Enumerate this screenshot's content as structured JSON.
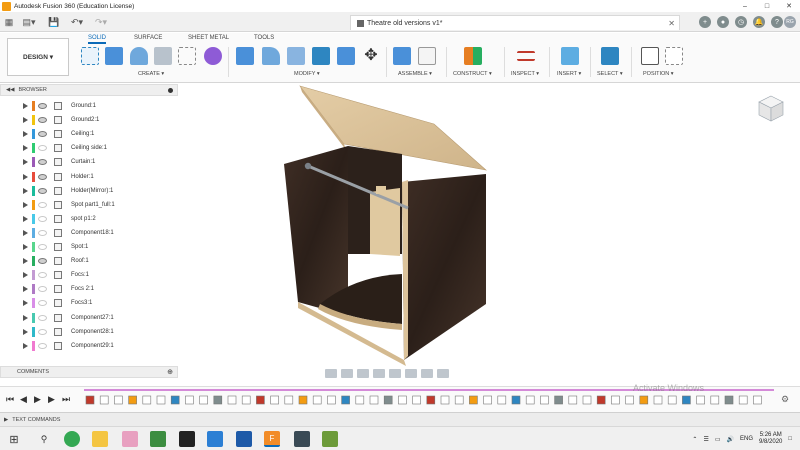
{
  "window": {
    "title": "Autodesk Fusion 360 (Education License)"
  },
  "document_tab": {
    "name": "Theatre old versions v1*"
  },
  "user": {
    "initials": "RG"
  },
  "workspace": {
    "label": "DESIGN ▾"
  },
  "ribbon_tabs": [
    {
      "label": "SOLID",
      "active": true
    },
    {
      "label": "SURFACE",
      "active": false
    },
    {
      "label": "SHEET METAL",
      "active": false
    },
    {
      "label": "TOOLS",
      "active": false
    }
  ],
  "tool_groups": [
    {
      "label": "CREATE ▾"
    },
    {
      "label": "MODIFY ▾"
    },
    {
      "label": "ASSEMBLE ▾"
    },
    {
      "label": "CONSTRUCT ▾"
    },
    {
      "label": "INSPECT ▾"
    },
    {
      "label": "INSERT ▾"
    },
    {
      "label": "SELECT ▾"
    },
    {
      "label": "POSITION ▾"
    }
  ],
  "browser": {
    "header": "BROWSER",
    "components": [
      {
        "label": "Ground:1",
        "color": "#e67e22",
        "visible": true
      },
      {
        "label": "Ground2:1",
        "color": "#f1c40f",
        "visible": true
      },
      {
        "label": "Ceiling:1",
        "color": "#3498db",
        "visible": true
      },
      {
        "label": "Ceiling side:1",
        "color": "#2ecc71",
        "visible": false
      },
      {
        "label": "Curtain:1",
        "color": "#9b59b6",
        "visible": true
      },
      {
        "label": "Holder:1",
        "color": "#e74c3c",
        "visible": true
      },
      {
        "label": "Holder(Mirror):1",
        "color": "#1abc9c",
        "visible": true
      },
      {
        "label": "Spot part1_full:1",
        "color": "#f39c12",
        "visible": false
      },
      {
        "label": "spot p1:2",
        "color": "#48c9e8",
        "visible": false
      },
      {
        "label": "Component18:1",
        "color": "#5dade2",
        "visible": false
      },
      {
        "label": "Spot:1",
        "color": "#58d68d",
        "visible": false
      },
      {
        "label": "Roof:1",
        "color": "#27ae60",
        "visible": true
      },
      {
        "label": "Focs:1",
        "color": "#c39bd3",
        "visible": false
      },
      {
        "label": "Focs 2:1",
        "color": "#af7ac5",
        "visible": false
      },
      {
        "label": "Focs3:1",
        "color": "#d98ee8",
        "visible": false
      },
      {
        "label": "Component27:1",
        "color": "#48c9b0",
        "visible": false
      },
      {
        "label": "Component28:1",
        "color": "#2eb8c9",
        "visible": false
      },
      {
        "label": "Component29:1",
        "color": "#f07ad0",
        "visible": false
      }
    ]
  },
  "comments": {
    "label": "COMMENTS"
  },
  "timeline": {
    "watermark": "Activate Windows"
  },
  "text_commands": {
    "label": "TEXT COMMANDS"
  },
  "taskbar": {
    "language": "ENG",
    "time": "5:26 AM",
    "date": "9/8/2020"
  },
  "colors": {
    "accent": "#0b6ab8",
    "wood_dark": "#3a2a22",
    "wood_light": "#dcc39b"
  }
}
